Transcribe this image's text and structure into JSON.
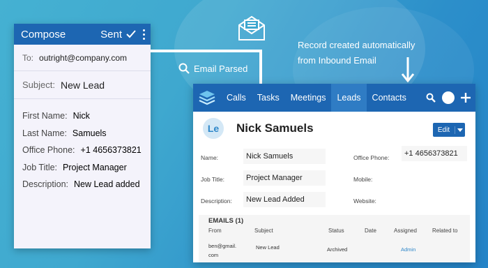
{
  "compose": {
    "title": "Compose",
    "sent_label": "Sent",
    "to_label": "To:",
    "to_value": "outright@company.com",
    "subject_label": "Subject:",
    "subject_value": "New Lead",
    "body": [
      {
        "label": "First Name:",
        "value": "Nick"
      },
      {
        "label": "Last Name:",
        "value": "Samuels"
      },
      {
        "label": "Office Phone:",
        "value": "+1 4656373821"
      },
      {
        "label": "Job Title:",
        "value": "Project Manager"
      },
      {
        "label": "Description:",
        "value": "New Lead added"
      }
    ]
  },
  "flow": {
    "parsed_label": "Email Parsed",
    "record_line1": "Record created automatically",
    "record_line2": "from Inbound Email"
  },
  "crm": {
    "nav": [
      "Calls",
      "Tasks",
      "Meetings",
      "Leads",
      "Contacts"
    ],
    "active_tab": "Leads",
    "avatar_initials": "Le",
    "record_name": "Nick Samuels",
    "edit_label": "Edit",
    "fields_left": [
      {
        "label": "Name:",
        "value": "Nick Samuels"
      },
      {
        "label": "Job Title:",
        "value": "Project Manager"
      },
      {
        "label": "Description:",
        "value": "New Lead Added"
      }
    ],
    "fields_right": [
      {
        "label": "Office Phone:",
        "value": "+1 4656373821"
      },
      {
        "label": "Mobile:",
        "value": ""
      },
      {
        "label": "Website:",
        "value": ""
      }
    ],
    "emails": {
      "title": "EMAILS (1)",
      "headers": [
        "From",
        "Subject",
        "Status",
        "Date",
        "Assigned",
        "Related to"
      ],
      "row": {
        "from_line1": "ben@gmail.",
        "from_line2": "com",
        "subject": "New Lead",
        "status": "Archived",
        "date": "",
        "assigned": "Admin",
        "related": ""
      }
    }
  },
  "colors": {
    "brand": "#1d66b2",
    "bg_start": "#45b1d2",
    "bg_end": "#2483c7",
    "link": "#2e87c9"
  }
}
